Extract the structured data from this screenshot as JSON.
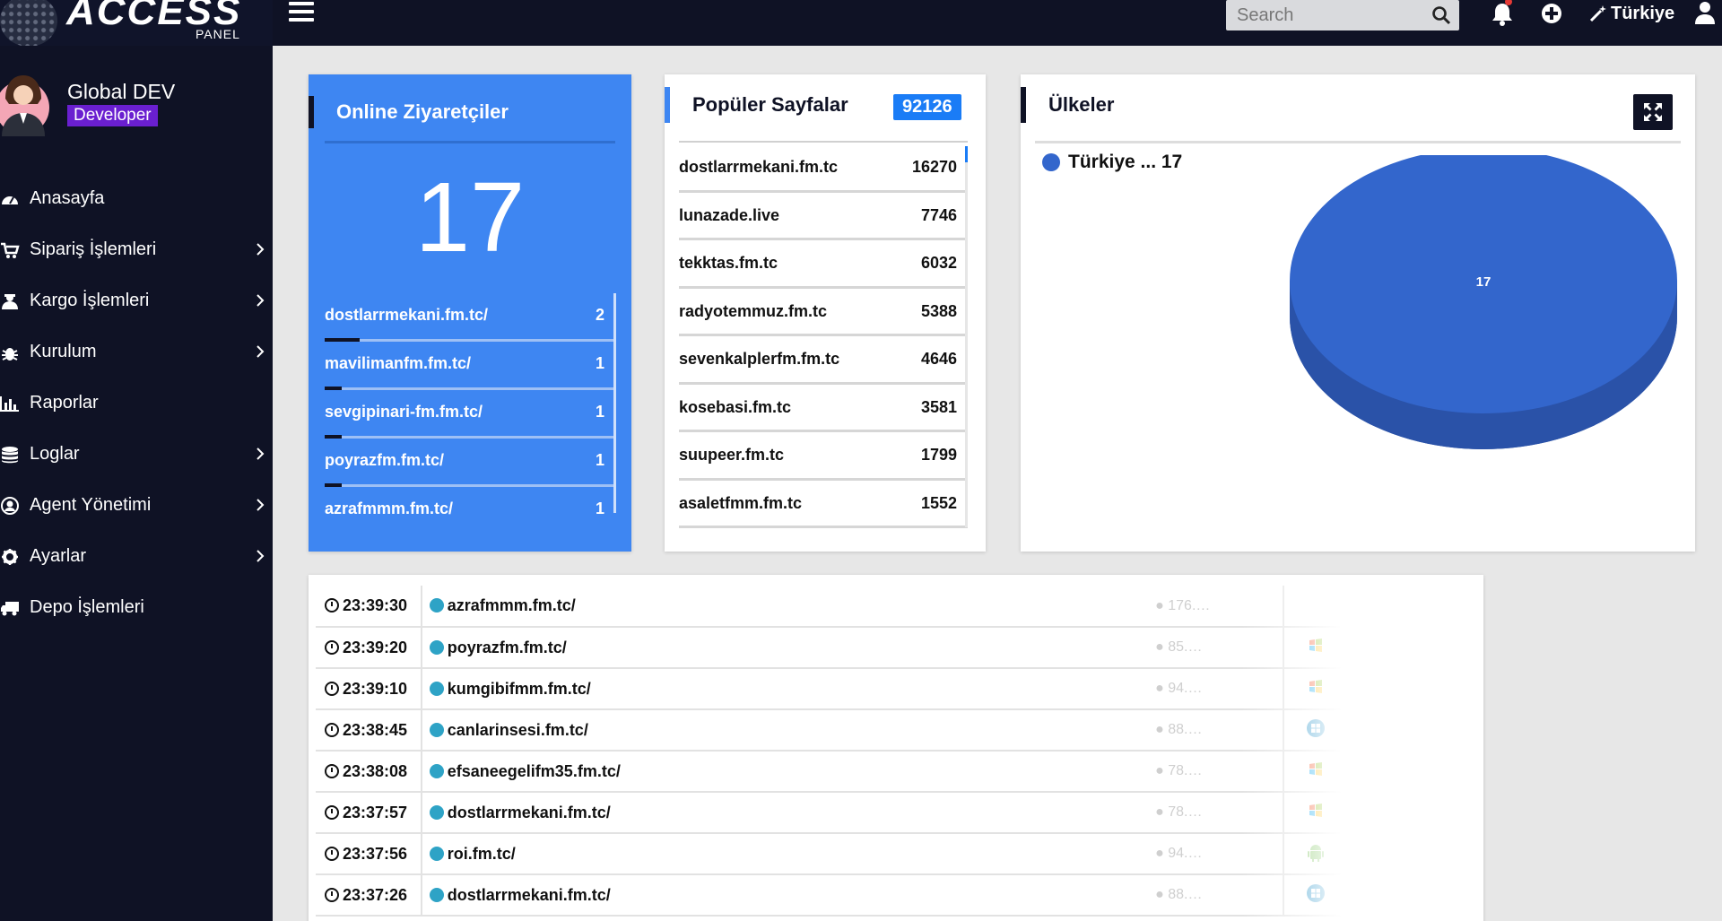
{
  "brand": {
    "name": "ACCESS",
    "sub": "PANEL"
  },
  "topbar": {
    "search_placeholder": "Search",
    "language": "Türkiye"
  },
  "profile": {
    "name": "Global DEV",
    "role": "Developer"
  },
  "nav": [
    {
      "label": "Anasayfa",
      "icon": "dashboard-icon",
      "submenu": false
    },
    {
      "label": "Sipariş İşlemleri",
      "icon": "cart-icon",
      "submenu": true
    },
    {
      "label": "Kargo İşlemleri",
      "icon": "courier-icon",
      "submenu": true
    },
    {
      "label": "Kurulum",
      "icon": "bug-icon",
      "submenu": true
    },
    {
      "label": "Raporlar",
      "icon": "bar-chart-icon",
      "submenu": false
    },
    {
      "label": "Loglar",
      "icon": "database-icon",
      "submenu": true
    },
    {
      "label": "Agent Yönetimi",
      "icon": "user-circle-icon",
      "submenu": true
    },
    {
      "label": "Ayarlar",
      "icon": "gear-icon",
      "submenu": true
    },
    {
      "label": "Depo İşlemleri",
      "icon": "truck-icon",
      "submenu": false
    }
  ],
  "online": {
    "title": "Online Ziyaretçiler",
    "count": "17",
    "items": [
      {
        "url": "dostlarrmekani.fm.tc/",
        "count": "2",
        "share": 0.12
      },
      {
        "url": "mavilimanfm.fm.tc/",
        "count": "1",
        "share": 0.06
      },
      {
        "url": "sevgipinari-fm.fm.tc/",
        "count": "1",
        "share": 0.06
      },
      {
        "url": "poyrazfm.fm.tc/",
        "count": "1",
        "share": 0.06
      },
      {
        "url": "azrafmmm.fm.tc/",
        "count": "1",
        "share": 0.06
      }
    ]
  },
  "pages": {
    "title": "Popüler Sayfalar",
    "total": "92126",
    "items": [
      {
        "name": "dostlarrmekani.fm.tc",
        "count": "16270"
      },
      {
        "name": "lunazade.live",
        "count": "7746"
      },
      {
        "name": "tekktas.fm.tc",
        "count": "6032"
      },
      {
        "name": "radyotemmuz.fm.tc",
        "count": "5388"
      },
      {
        "name": "sevenkalplerfm.fm.tc",
        "count": "4646"
      },
      {
        "name": "kosebasi.fm.tc",
        "count": "3581"
      },
      {
        "name": "suupeer.fm.tc",
        "count": "1799"
      },
      {
        "name": "asaletfmm.fm.tc",
        "count": "1552"
      }
    ]
  },
  "countries": {
    "title": "Ülkeler",
    "legend": "Türkiye ... 17",
    "pie_label": "17",
    "colors": {
      "slice_top": "#3366cc",
      "slice_side": "#2a52a8"
    }
  },
  "log": [
    {
      "time": "23:39:30",
      "url": "azrafmmm.fm.tc/",
      "ip": "176.…",
      "os": "",
      "browser": "ie"
    },
    {
      "time": "23:39:20",
      "url": "poyrazfm.fm.tc/",
      "ip": "85.…",
      "os": "windows-old",
      "browser": "ie"
    },
    {
      "time": "23:39:10",
      "url": "kumgibifmm.fm.tc/",
      "ip": "94.…",
      "os": "windows-old",
      "browser": "ie"
    },
    {
      "time": "23:38:45",
      "url": "canlarinsesi.fm.tc/",
      "ip": "88.…",
      "os": "windows",
      "browser": "chrome"
    },
    {
      "time": "23:38:08",
      "url": "efsaneegelifm35.fm.tc/",
      "ip": "78.…",
      "os": "windows-old",
      "browser": "ie"
    },
    {
      "time": "23:37:57",
      "url": "dostlarrmekani.fm.tc/",
      "ip": "78.…",
      "os": "windows-old",
      "browser": ""
    },
    {
      "time": "23:37:56",
      "url": "roi.fm.tc/",
      "ip": "94.…",
      "os": "android",
      "browser": "chrome"
    },
    {
      "time": "23:37:26",
      "url": "dostlarrmekani.fm.tc/",
      "ip": "88.…",
      "os": "windows",
      "browser": "chrome"
    }
  ]
}
